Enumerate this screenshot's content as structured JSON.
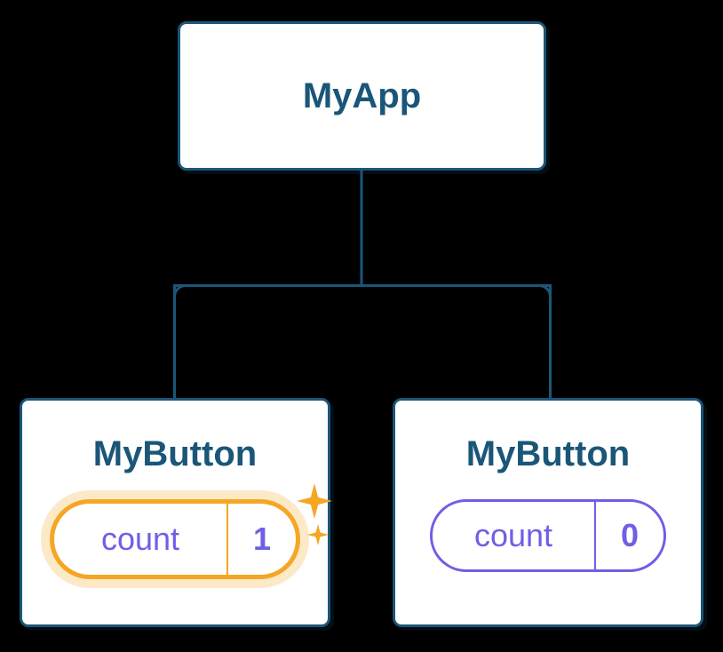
{
  "root": {
    "title": "MyApp"
  },
  "children": [
    {
      "title": "MyButton",
      "state_label": "count",
      "state_value": "1",
      "highlighted": true
    },
    {
      "title": "MyButton",
      "state_label": "count",
      "state_value": "0",
      "highlighted": false
    }
  ]
}
